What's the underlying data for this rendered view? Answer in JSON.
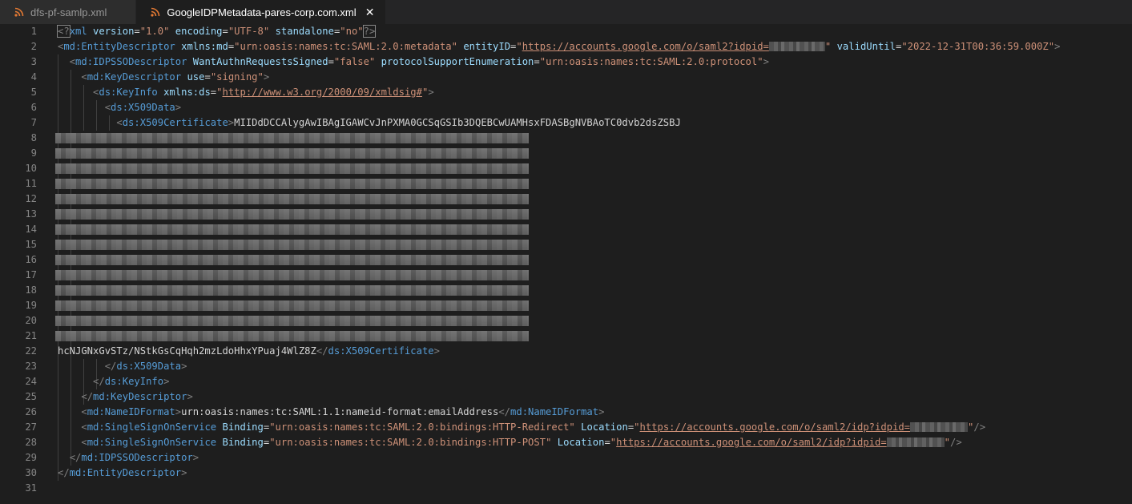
{
  "tabs": [
    {
      "label": "dfs-pf-samlp.xml",
      "active": false
    },
    {
      "label": "GoogleIDPMetadata-pares-corp.com.xml",
      "active": true
    }
  ],
  "colors": {
    "rss_icon": "#e37933",
    "tag": "#569cd6",
    "attribute": "#9cdcfe",
    "string": "#ce9178",
    "punctuation": "#808080",
    "text": "#d4d4d4"
  },
  "line_numbers": [
    "1",
    "2",
    "3",
    "4",
    "5",
    "6",
    "7",
    "8",
    "9",
    "10",
    "11",
    "12",
    "13",
    "14",
    "15",
    "16",
    "17",
    "18",
    "19",
    "20",
    "21",
    "22",
    "23",
    "24",
    "25",
    "26",
    "27",
    "28",
    "29",
    "30",
    "31"
  ],
  "code": {
    "l1": {
      "pi_open": "<?",
      "pi_name": "xml",
      "a1": "version",
      "v1": "\"1.0\"",
      "a2": "encoding",
      "v2": "\"UTF-8\"",
      "a3": "standalone",
      "v3": "\"no\"",
      "pi_close": "?>"
    },
    "l2": {
      "tag": "md:EntityDescriptor",
      "a1": "xmlns:md",
      "v1": "\"urn:oasis:names:tc:SAML:2.0:metadata\"",
      "a2": "entityID",
      "q": "\"",
      "url": "https://accounts.google.com/o/saml2?idpid=",
      "a3": "validUntil",
      "v3": "\"2022-12-31T00:36:59.000Z\""
    },
    "l3": {
      "tag": "md:IDPSSODescriptor",
      "a1": "WantAuthnRequestsSigned",
      "v1": "\"false\"",
      "a2": "protocolSupportEnumeration",
      "v2": "\"urn:oasis:names:tc:SAML:2.0:protocol\""
    },
    "l4": {
      "tag": "md:KeyDescriptor",
      "a1": "use",
      "v1": "\"signing\""
    },
    "l5": {
      "tag": "ds:KeyInfo",
      "a1": "xmlns:ds",
      "url": "http://www.w3.org/2000/09/xmldsig#"
    },
    "l6": {
      "tag": "ds:X509Data"
    },
    "l7": {
      "tag": "ds:X509Certificate",
      "text": "MIIDdDCCAlygAwIBAgIGAWCvJnPXMA0GCSqGSIb3DQEBCwUAMHsxFDASBgNVBAoTC0dvb2dsZSBJ"
    },
    "l22": {
      "text": "hcNJGNxGvSTz/NStkGsCqHqh2mzLdoHhxYPuaj4WlZ8Z",
      "tag": "ds:X509Certificate"
    },
    "l23": {
      "tag": "ds:X509Data"
    },
    "l24": {
      "tag": "ds:KeyInfo"
    },
    "l25": {
      "tag": "md:KeyDescriptor"
    },
    "l26": {
      "tag": "md:NameIDFormat",
      "text": "urn:oasis:names:tc:SAML:1.1:nameid-format:emailAddress"
    },
    "l27": {
      "tag": "md:SingleSignOnService",
      "a1": "Binding",
      "v1": "\"urn:oasis:names:tc:SAML:2.0:bindings:HTTP-Redirect\"",
      "a2": "Location",
      "url": "https://accounts.google.com/o/saml2/idp?idpid="
    },
    "l28": {
      "tag": "md:SingleSignOnService",
      "a1": "Binding",
      "v1": "\"urn:oasis:names:tc:SAML:2.0:bindings:HTTP-POST\"",
      "a2": "Location",
      "url": "https://accounts.google.com/o/saml2/idp?idpid="
    },
    "l29": {
      "tag": "md:IDPSSODescriptor"
    },
    "l30": {
      "tag": "md:EntityDescriptor"
    }
  }
}
